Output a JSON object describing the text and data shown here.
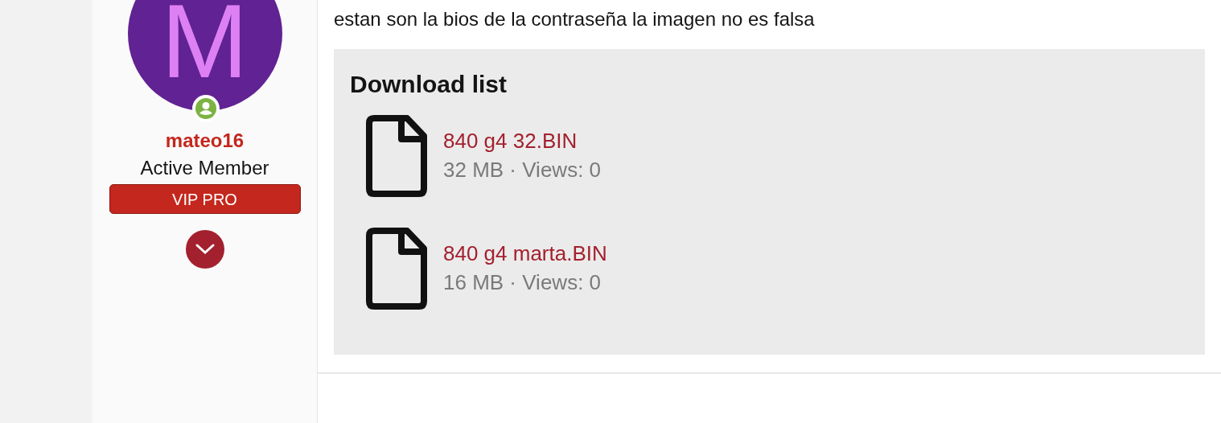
{
  "user": {
    "avatar_letter": "M",
    "username": "mateo16",
    "title": "Active Member",
    "badge": "VIP PRO",
    "online": true
  },
  "post": {
    "text": "estan son la bios de la contraseña la imagen no es falsa"
  },
  "download_list": {
    "title": "Download list",
    "files": [
      {
        "name": "840 g4 32.BIN",
        "meta": "32 MB · Views: 0"
      },
      {
        "name": "840 g4 marta.BIN",
        "meta": "16 MB · Views: 0"
      }
    ]
  }
}
